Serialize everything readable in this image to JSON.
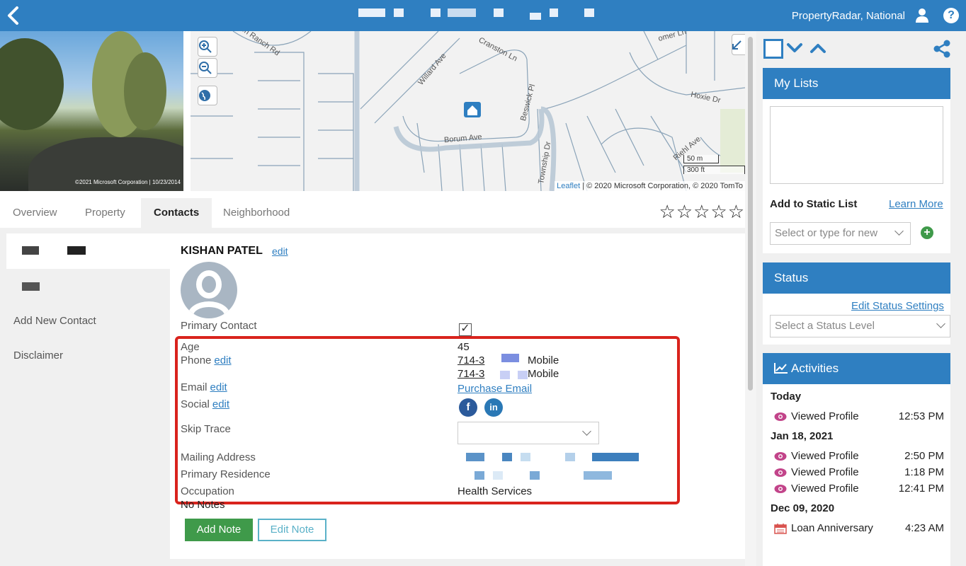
{
  "header": {
    "account": "PropertyRadar, National",
    "colors": {
      "brand": "#2f7fc1"
    }
  },
  "photo": {
    "credit": "©2021 Microsoft Corporation | 10/23/2014"
  },
  "map": {
    "streets": [
      "Cranston Ln",
      "Willard Ave",
      "Beswick Pl",
      "Borum Ave",
      "Township Dr",
      "Hoxie Dr",
      "Riehl Ave",
      "on Ranch Rd",
      "omer Ln"
    ],
    "scale_metric": "50 m",
    "scale_imperial": "300 ft",
    "attribution_link": "Leaflet",
    "attribution_text": "| © 2020 Microsoft Corporation, © 2020 TomTo"
  },
  "tabs": [
    {
      "label": "Overview"
    },
    {
      "label": "Property"
    },
    {
      "label": "Contacts",
      "active": true
    },
    {
      "label": "Neighborhood"
    }
  ],
  "rating": "☆☆☆☆☆",
  "sidenav": {
    "add_contact": "Add New Contact",
    "disclaimer": "Disclaimer"
  },
  "contact": {
    "name": "KISHAN PATEL",
    "edit": "edit",
    "primary_contact_label": "Primary Contact",
    "primary_contact_checked": "✓",
    "age_label": "Age",
    "age": "45",
    "phone_label": "Phone",
    "phones": [
      {
        "number": "714-3",
        "type": "Mobile"
      },
      {
        "number": "714-3",
        "type": "Mobile"
      }
    ],
    "email_label": "Email",
    "purchase_email": "Purchase Email",
    "social_label": "Social",
    "facebook": "f",
    "linkedin": "in",
    "skip_trace_label": "Skip Trace",
    "mailing_label": "Mailing Address",
    "residence_label": "Primary Residence",
    "occupation_label": "Occupation",
    "occupation": "Health Services",
    "notes": "No Notes",
    "add_note": "Add Note",
    "edit_note": "Edit Note"
  },
  "right": {
    "my_lists": "My Lists",
    "add_static": "Add to Static List",
    "learn_more": "Learn More",
    "list_placeholder": "Select or type for new",
    "status": "Status",
    "edit_status": "Edit Status Settings",
    "status_placeholder": "Select a Status Level",
    "activities": "Activities",
    "activity_groups": [
      {
        "day": "Today",
        "items": [
          {
            "text": "Viewed Profile",
            "time": "12:53 PM"
          }
        ]
      },
      {
        "day": "Jan 18, 2021",
        "items": [
          {
            "text": "Viewed Profile",
            "time": "2:50 PM"
          },
          {
            "text": "Viewed Profile",
            "time": "1:18 PM"
          },
          {
            "text": "Viewed Profile",
            "time": "12:41 PM"
          }
        ]
      },
      {
        "day": "Dec 09, 2020",
        "items": [
          {
            "text": "Loan Anniversary",
            "time": "4:23 AM"
          }
        ]
      }
    ]
  }
}
